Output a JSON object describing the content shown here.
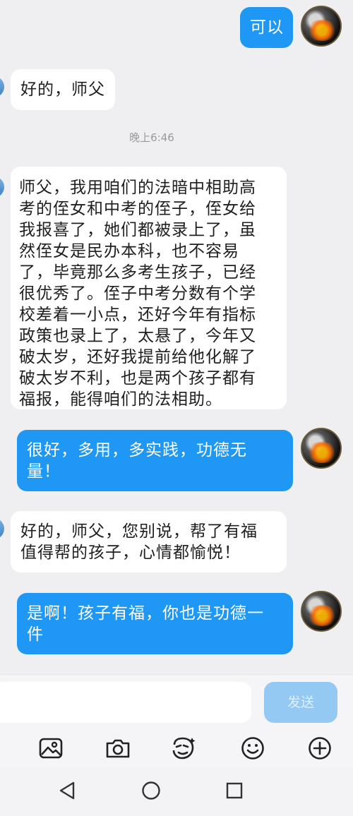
{
  "messages": [
    {
      "side": "out",
      "text": "可以"
    },
    {
      "side": "in",
      "text": "好的，师父"
    },
    {
      "type": "timestamp",
      "text": "晚上6:46"
    },
    {
      "side": "in",
      "lines": [
        "师父，我用咱们的法暗中相助高",
        "考的侄女和中考的侄子，侄女给",
        "我报喜了，她们都被录上了，虽",
        "然侄女是民办本科，也不容易",
        "了，毕竟那么多考生孩子，已经",
        "很优秀了。侄子中考分数有个学",
        "校差着一小点，还好今年有指标",
        "政策也录上了，太悬了，今年又",
        "破太岁，还好我提前给他化解了",
        "破太岁不利，也是两个孩子都有",
        "福报，能得咱们的法相助。"
      ]
    },
    {
      "side": "out",
      "lines": [
        "很好，多用，多实践，功德无",
        "量！"
      ]
    },
    {
      "side": "in",
      "lines": [
        "好的，师父，您别说，帮了有福",
        "值得帮的孩子，心情都愉悦！"
      ]
    },
    {
      "side": "out",
      "lines": [
        "是啊！孩子有福，你也是功德一",
        "件"
      ]
    }
  ],
  "composer": {
    "send_label": "发送",
    "input_placeholder": ""
  },
  "toolbar": {
    "icons": [
      "image-icon",
      "camera-icon",
      "sticker-icon",
      "emoji-icon",
      "plus-icon"
    ]
  },
  "navbar": {
    "icons": [
      "back-icon",
      "home-icon",
      "recents-icon"
    ]
  },
  "colors": {
    "out_bubble": "#1e98f4",
    "in_bubble": "#ffffff",
    "background": "#efeff1",
    "send_disabled": "#93c9f2"
  }
}
